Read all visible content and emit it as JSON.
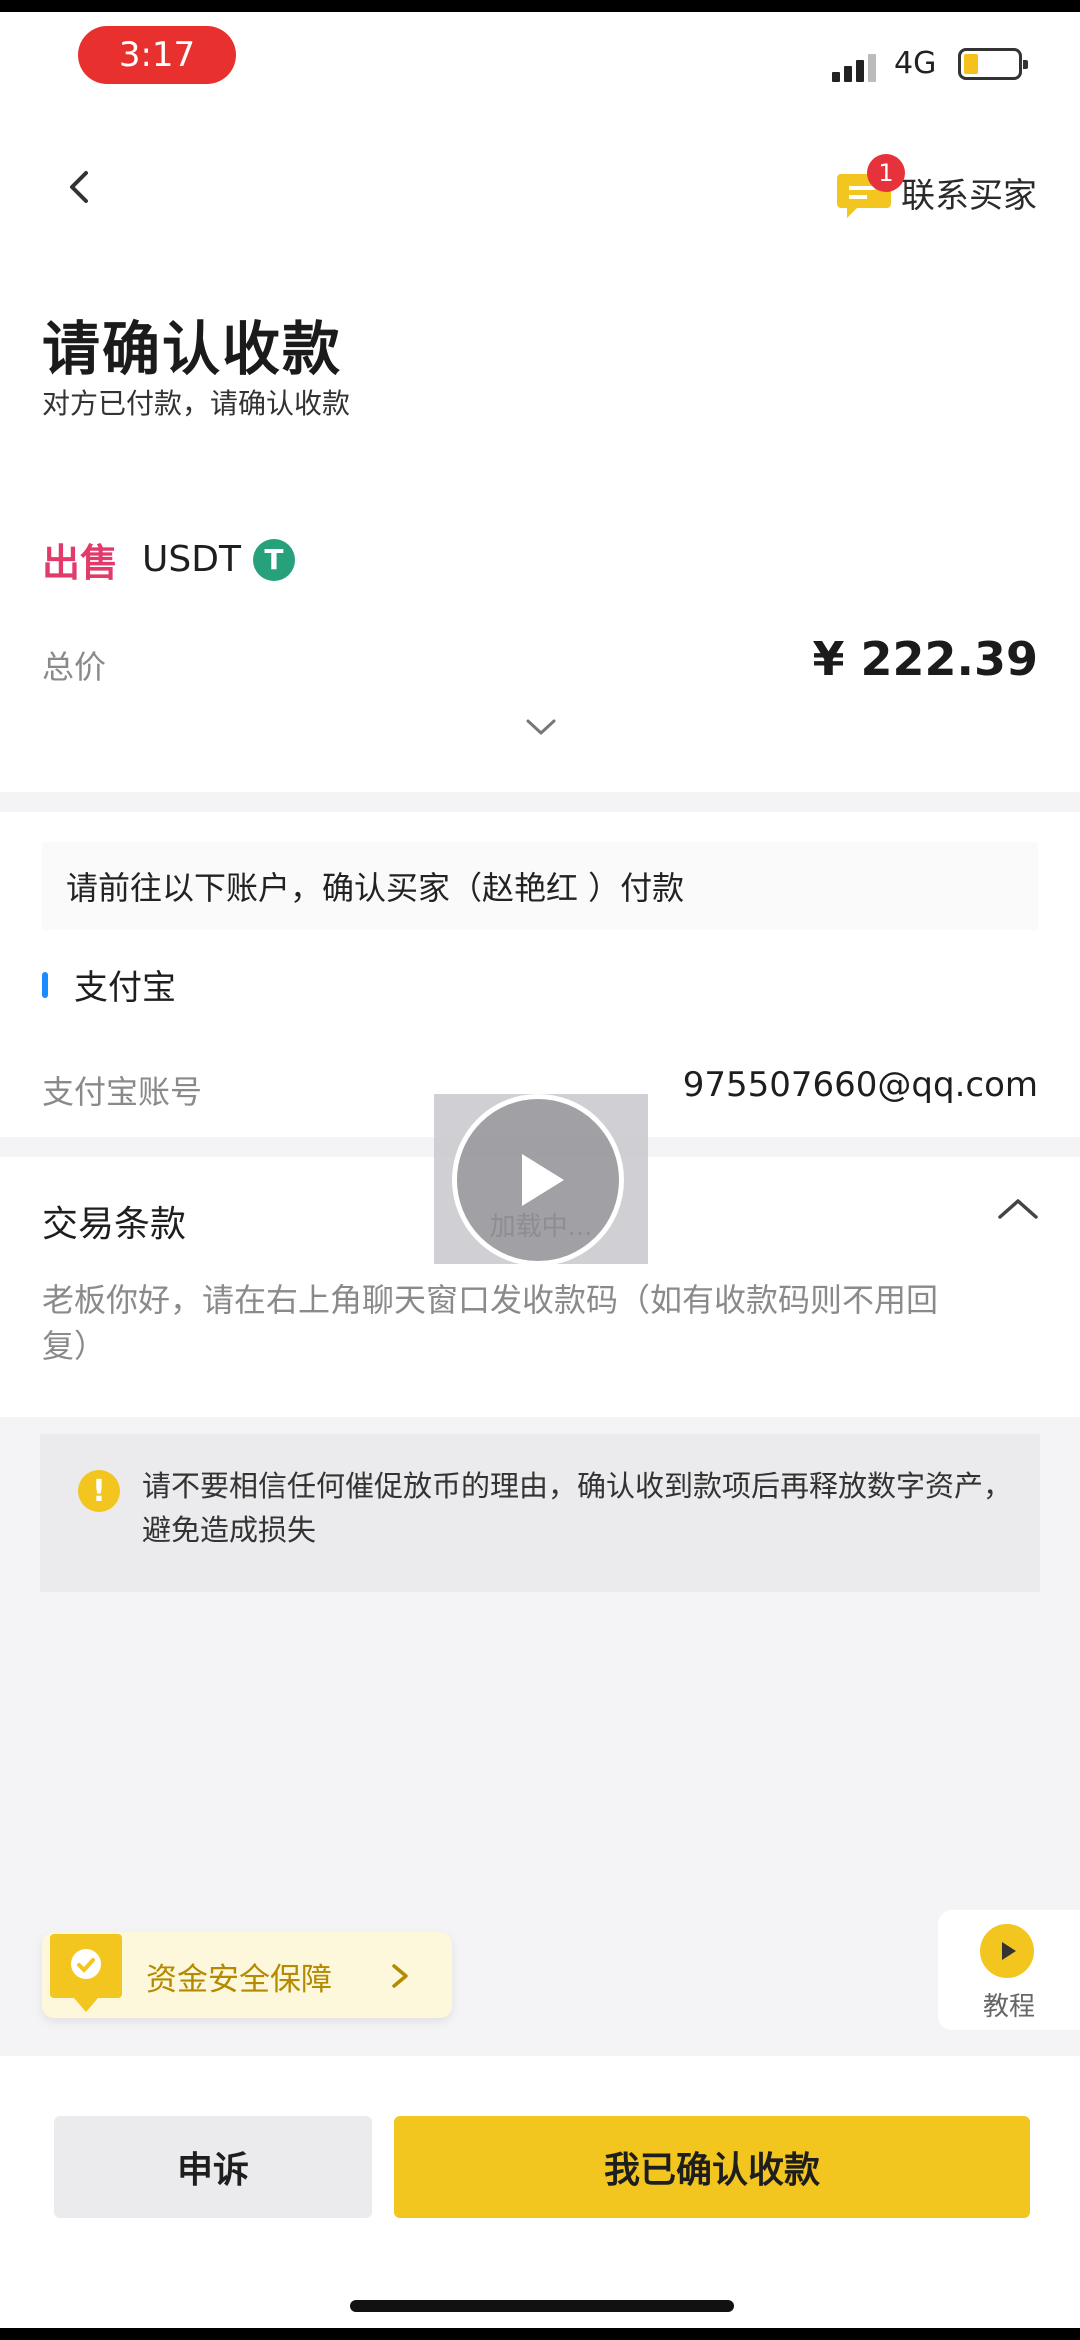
{
  "status_bar": {
    "time": "3:17",
    "network": "4G"
  },
  "header": {
    "contact_label": "联系买家",
    "unread_badge": "1",
    "title": "请确认收款",
    "subtitle": "对方已付款，请确认收款"
  },
  "order": {
    "side": "出售",
    "coin": "USDT",
    "coin_icon": "T",
    "total_label": "总价",
    "total_value": "¥ 222.39"
  },
  "payment": {
    "hint": "请前往以下账户，确认买家（赵艳红 ）付款",
    "method": "支付宝",
    "account_label": "支付宝账号",
    "account_value": "975507660@qq.com"
  },
  "terms": {
    "title": "交易条款",
    "text": "老板你好，请在右上角聊天窗口发收款码（如有收款码则不用回复）"
  },
  "warning": {
    "icon": "!",
    "text": "请不要相信任何催促放币的理由，确认收到款项后再释放数字资产，避免造成损失"
  },
  "overlay": {
    "loading_text": "加载中..."
  },
  "safety": {
    "label": "资金安全保障"
  },
  "tutorial": {
    "label": "教程"
  },
  "actions": {
    "appeal": "申诉",
    "confirm": "我已确认收款"
  },
  "colors": {
    "accent": "#f3c51f",
    "sell": "#e23a6b",
    "tether": "#26a17b",
    "badge": "#e5323b"
  },
  "icons": [
    "back-icon",
    "chat-icon",
    "tether-icon",
    "chevron-down-icon",
    "chevron-up-icon",
    "warning-icon",
    "play-icon",
    "shield-icon",
    "chevron-right-icon"
  ]
}
